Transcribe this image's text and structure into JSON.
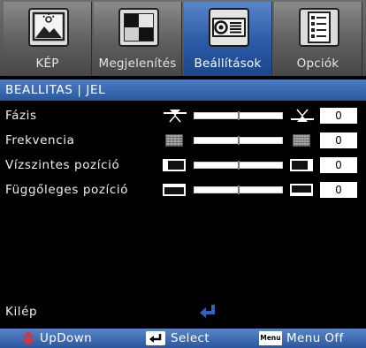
{
  "tabs": [
    {
      "label": "KÉP",
      "icon": "picture-icon",
      "active": false
    },
    {
      "label": "Megjelenítés",
      "icon": "display-icon",
      "active": false
    },
    {
      "label": "Beállítások",
      "icon": "projector-icon",
      "active": true
    },
    {
      "label": "Opciók",
      "icon": "options-icon",
      "active": false
    }
  ],
  "header": {
    "title": "BEALLITAS | JEL"
  },
  "settings": [
    {
      "label": "Fázis",
      "value": "0",
      "icon_left": "phase-minus-icon",
      "icon_right": "phase-plus-icon"
    },
    {
      "label": "Frekvencia",
      "value": "0",
      "icon_left": "frequency-minus-icon",
      "icon_right": "frequency-plus-icon"
    },
    {
      "label": "Vízszintes pozíció",
      "value": "0",
      "icon_left": "h-position-left-icon",
      "icon_right": "h-position-right-icon"
    },
    {
      "label": "Függőleges pozíció",
      "value": "0",
      "icon_left": "v-position-down-icon",
      "icon_right": "v-position-up-icon"
    }
  ],
  "exit": {
    "label": "Kilép",
    "icon": "enter-icon"
  },
  "help": {
    "updown": {
      "label": "UpDown",
      "icon": "updown-arrows-icon"
    },
    "select": {
      "label": "Select",
      "icon": "enter-key-icon"
    },
    "menu": {
      "label": "Menu Off",
      "key": "Menu",
      "icon": "menu-key-icon"
    }
  },
  "colors": {
    "accent": "#2a5aa6",
    "tab_inactive": "#5e5e5e",
    "enter_icon": "#2f63c0",
    "updown_icon": "#e0303a"
  }
}
